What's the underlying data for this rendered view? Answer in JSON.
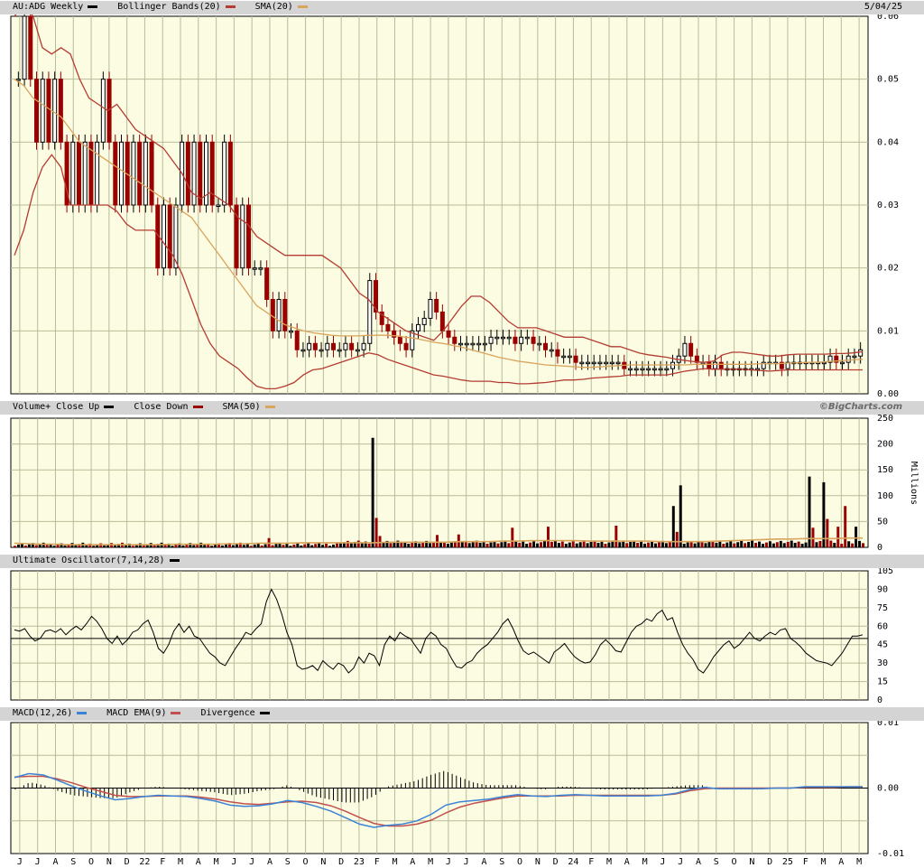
{
  "colors": {
    "up": "#000000",
    "down": "#9a0000",
    "band": "#b43c32",
    "sma": "#d9a45c",
    "macd": "#3b83d6",
    "macd_ema": "#c0504d",
    "grid": "#b8bc98",
    "panel_bg": "#fcfce2"
  },
  "price_panel": {
    "title_parts": [
      "AU:ADG Weekly",
      "Bollinger Bands(20)",
      "SMA(20)"
    ],
    "date": "5/04/25",
    "y_labels": [
      "0.06",
      "0.05",
      "0.04",
      "0.03",
      "0.02",
      "0.01",
      "0.00"
    ]
  },
  "volume_panel": {
    "title_parts": [
      "Volume+ Close Up",
      "Close Down",
      "SMA(50)"
    ],
    "brand": "©BigCharts.com",
    "y_labels": [
      "250",
      "200",
      "150",
      "100",
      "50",
      "0"
    ],
    "unit_label": "Millions"
  },
  "uo_panel": {
    "title": "Ultimate Oscillator(7,14,28)",
    "y_labels": [
      "105",
      "90",
      "75",
      "60",
      "45",
      "30",
      "15",
      "0"
    ]
  },
  "macd_panel": {
    "title_parts": [
      "MACD(12,26)",
      "MACD EMA(9)",
      "Divergence"
    ],
    "y_labels": [
      "0.01",
      "0.00",
      "-0.01"
    ]
  },
  "x_labels": [
    "J",
    "J",
    "A",
    "S",
    "O",
    "N",
    "D",
    "22",
    "F",
    "M",
    "A",
    "M",
    "J",
    "J",
    "A",
    "S",
    "O",
    "N",
    "D",
    "23",
    "F",
    "M",
    "A",
    "M",
    "J",
    "J",
    "A",
    "S",
    "O",
    "N",
    "D",
    "24",
    "F",
    "M",
    "A",
    "M",
    "J",
    "J",
    "A",
    "S",
    "O",
    "N",
    "D",
    "25",
    "F",
    "M",
    "A",
    "M"
  ],
  "chart_data": [
    {
      "type": "candlestick",
      "title": "AU:ADG Weekly",
      "ylim": [
        0,
        0.06
      ],
      "series": [
        {
          "name": "AU:ADG Weekly",
          "closes": [
            0.05,
            0.06,
            0.05,
            0.04,
            0.05,
            0.04,
            0.05,
            0.04,
            0.03,
            0.04,
            0.03,
            0.04,
            0.03,
            0.04,
            0.05,
            0.04,
            0.03,
            0.04,
            0.03,
            0.04,
            0.03,
            0.04,
            0.03,
            0.02,
            0.03,
            0.02,
            0.03,
            0.04,
            0.03,
            0.04,
            0.03,
            0.04,
            0.03,
            0.03,
            0.04,
            0.03,
            0.02,
            0.03,
            0.02,
            0.02,
            0.02,
            0.015,
            0.01,
            0.015,
            0.01,
            0.01,
            0.007,
            0.007,
            0.008,
            0.007,
            0.007,
            0.008,
            0.007,
            0.007,
            0.008,
            0.007,
            0.007,
            0.008,
            0.018,
            0.013,
            0.011,
            0.01,
            0.009,
            0.008,
            0.007,
            0.01,
            0.011,
            0.012,
            0.015,
            0.013,
            0.01,
            0.009,
            0.008,
            0.008,
            0.008,
            0.008,
            0.008,
            0.008,
            0.009,
            0.009,
            0.009,
            0.009,
            0.008,
            0.009,
            0.009,
            0.008,
            0.008,
            0.007,
            0.007,
            0.006,
            0.006,
            0.006,
            0.005,
            0.005,
            0.005,
            0.005,
            0.005,
            0.005,
            0.005,
            0.005,
            0.004,
            0.004,
            0.004,
            0.004,
            0.004,
            0.004,
            0.004,
            0.004,
            0.005,
            0.006,
            0.008,
            0.006,
            0.005,
            0.005,
            0.004,
            0.005,
            0.004,
            0.004,
            0.004,
            0.004,
            0.004,
            0.004,
            0.004,
            0.005,
            0.005,
            0.005,
            0.004,
            0.005,
            0.005,
            0.005,
            0.005,
            0.005,
            0.005,
            0.005,
            0.006,
            0.005,
            0.005,
            0.006,
            0.006,
            0.007
          ]
        },
        {
          "name": "Bollinger Bands(20) upper",
          "values": [
            0.06,
            0.062,
            0.06,
            0.055,
            0.054,
            0.055,
            0.054,
            0.05,
            0.047,
            0.046,
            0.045,
            0.046,
            0.044,
            0.042,
            0.041,
            0.04,
            0.039,
            0.037,
            0.035,
            0.032,
            0.031,
            0.032,
            0.031,
            0.03,
            0.028,
            0.027,
            0.025,
            0.024,
            0.023,
            0.022,
            0.022,
            0.022,
            0.022,
            0.022,
            0.021,
            0.02,
            0.018,
            0.016,
            0.015,
            0.013,
            0.012,
            0.011,
            0.01,
            0.0095,
            0.009,
            0.0085,
            0.01,
            0.012,
            0.014,
            0.0155,
            0.0155,
            0.0145,
            0.013,
            0.0115,
            0.0105,
            0.0105,
            0.0105,
            0.01,
            0.0095,
            0.009,
            0.009,
            0.009,
            0.0085,
            0.008,
            0.0075,
            0.0075,
            0.007,
            0.0065,
            0.0062,
            0.006,
            0.0058,
            0.0055,
            0.0053,
            0.0051,
            0.005,
            0.0052,
            0.0062,
            0.0066,
            0.0066,
            0.0064,
            0.0062,
            0.006,
            0.006,
            0.0062,
            0.0063,
            0.0063,
            0.0063,
            0.0063,
            0.0064,
            0.0064,
            0.0065,
            0.0067
          ]
        },
        {
          "name": "Bollinger Bands(20) lower",
          "values": [
            0.022,
            0.026,
            0.032,
            0.036,
            0.038,
            0.036,
            0.03,
            0.03,
            0.03,
            0.03,
            0.03,
            0.029,
            0.027,
            0.026,
            0.026,
            0.026,
            0.024,
            0.022,
            0.019,
            0.015,
            0.011,
            0.008,
            0.006,
            0.005,
            0.004,
            0.0025,
            0.0012,
            0.0008,
            0.0008,
            0.0012,
            0.0018,
            0.003,
            0.0038,
            0.004,
            0.0045,
            0.005,
            0.0055,
            0.006,
            0.0065,
            0.0062,
            0.0055,
            0.005,
            0.0045,
            0.004,
            0.0035,
            0.003,
            0.0028,
            0.0025,
            0.0022,
            0.002,
            0.002,
            0.002,
            0.0018,
            0.0018,
            0.0016,
            0.0016,
            0.0017,
            0.0018,
            0.002,
            0.0022,
            0.0022,
            0.0023,
            0.0025,
            0.0026,
            0.0027,
            0.0028,
            0.003,
            0.003,
            0.003,
            0.003,
            0.003,
            0.0033,
            0.0036,
            0.0038,
            0.004,
            0.0039,
            0.0039,
            0.0039,
            0.0039,
            0.0038,
            0.0037,
            0.0036,
            0.0037,
            0.0038,
            0.0038,
            0.0038,
            0.0038,
            0.0038,
            0.0038,
            0.0038,
            0.0038,
            0.0038
          ]
        },
        {
          "name": "SMA(20)",
          "values": [
            0.05,
            0.049,
            0.047,
            0.046,
            0.045,
            0.044,
            0.042,
            0.04,
            0.039,
            0.038,
            0.037,
            0.036,
            0.035,
            0.034,
            0.033,
            0.032,
            0.031,
            0.03,
            0.029,
            0.028,
            0.026,
            0.024,
            0.022,
            0.02,
            0.018,
            0.016,
            0.014,
            0.013,
            0.012,
            0.011,
            0.0105,
            0.01,
            0.0097,
            0.0095,
            0.0093,
            0.0092,
            0.0092,
            0.0092,
            0.0093,
            0.0093,
            0.0093,
            0.0092,
            0.009,
            0.0088,
            0.0085,
            0.0082,
            0.008,
            0.0077,
            0.0074,
            0.007,
            0.0066,
            0.0062,
            0.0058,
            0.0055,
            0.0052,
            0.005,
            0.0048,
            0.0046,
            0.0045,
            0.0044,
            0.0043,
            0.0042,
            0.0042,
            0.0043,
            0.0044,
            0.0045,
            0.0046,
            0.0046,
            0.0046,
            0.0046,
            0.0046,
            0.0046,
            0.0046,
            0.0047,
            0.0047,
            0.0047,
            0.0047,
            0.0047,
            0.0047,
            0.0047,
            0.0048,
            0.0048,
            0.0048,
            0.0049,
            0.0049,
            0.005,
            0.005,
            0.0051,
            0.0052,
            0.0053,
            0.0054,
            0.0055
          ]
        }
      ]
    },
    {
      "type": "bar",
      "title": "Volume+",
      "ylabel": "Millions",
      "ylim": [
        0,
        250
      ],
      "spikes": [
        {
          "idx": 100,
          "v": 212,
          "up": true
        },
        {
          "idx": 101,
          "v": 57,
          "up": false
        },
        {
          "idx": 102,
          "v": 22,
          "up": false
        },
        {
          "idx": 184,
          "v": 80,
          "up": true
        },
        {
          "idx": 185,
          "v": 30,
          "up": false
        },
        {
          "idx": 186,
          "v": 120,
          "up": true
        },
        {
          "idx": 222,
          "v": 137,
          "up": true
        },
        {
          "idx": 223,
          "v": 38,
          "up": false
        },
        {
          "idx": 226,
          "v": 126,
          "up": true
        },
        {
          "idx": 227,
          "v": 55,
          "up": false
        },
        {
          "idx": 232,
          "v": 80,
          "up": false
        },
        {
          "idx": 235,
          "v": 40,
          "up": true
        },
        {
          "idx": 230,
          "v": 40,
          "up": false
        },
        {
          "idx": 149,
          "v": 40,
          "up": false
        },
        {
          "idx": 139,
          "v": 38,
          "up": false
        },
        {
          "idx": 168,
          "v": 42,
          "up": false
        },
        {
          "idx": 71,
          "v": 18,
          "up": false
        },
        {
          "idx": 124,
          "v": 25,
          "up": false
        },
        {
          "idx": 118,
          "v": 24,
          "up": false
        }
      ],
      "sma50": [
        8,
        7,
        6,
        6,
        5,
        5,
        5,
        5,
        5,
        5,
        5,
        6,
        6,
        6,
        6,
        7,
        7,
        8,
        8,
        8,
        9,
        9,
        9,
        9,
        9,
        9,
        10,
        10,
        10,
        10,
        10,
        11,
        11,
        11,
        12,
        12,
        13,
        13,
        13,
        13,
        12,
        12,
        12,
        12,
        12,
        11,
        11,
        11,
        11,
        12,
        13,
        14,
        15,
        16,
        16,
        17,
        17,
        17,
        18,
        18
      ]
    },
    {
      "type": "line",
      "title": "Ultimate Oscillator(7,14,28)",
      "ylim": [
        0,
        105
      ],
      "reference": 50,
      "series": [
        {
          "name": "Ultimate Oscillator(7,14,28)",
          "values": [
            57,
            56,
            58,
            52,
            48,
            50,
            56,
            57,
            55,
            58,
            53,
            57,
            60,
            57,
            62,
            68,
            64,
            58,
            50,
            46,
            52,
            45,
            49,
            55,
            57,
            62,
            65,
            55,
            42,
            38,
            45,
            56,
            62,
            55,
            60,
            52,
            50,
            44,
            38,
            35,
            30,
            28,
            35,
            42,
            48,
            55,
            53,
            58,
            62,
            80,
            90,
            82,
            70,
            55,
            45,
            28,
            25,
            26,
            28,
            24,
            32,
            28,
            25,
            30,
            28,
            22,
            26,
            35,
            30,
            38,
            36,
            28,
            45,
            52,
            48,
            55,
            52,
            50,
            44,
            38,
            50,
            55,
            52,
            45,
            42,
            34,
            27,
            26,
            30,
            32,
            38,
            42,
            45,
            50,
            55,
            62,
            66,
            58,
            48,
            40,
            37,
            39,
            36,
            33,
            30,
            39,
            42,
            46,
            40,
            35,
            32,
            30,
            31,
            37,
            45,
            49,
            45,
            40,
            39,
            47,
            55,
            60,
            62,
            66,
            64,
            70,
            73,
            65,
            67,
            55,
            45,
            38,
            33,
            25,
            22,
            28,
            35,
            40,
            45,
            48,
            42,
            45,
            50,
            55,
            50,
            48,
            52,
            55,
            53,
            57,
            58,
            50,
            47,
            43,
            38,
            35,
            32,
            31,
            30,
            28,
            33,
            38,
            45,
            52,
            52,
            53
          ]
        }
      ]
    },
    {
      "type": "line",
      "title": "MACD(12,26)",
      "ylim": [
        -0.01,
        0.01
      ],
      "series": [
        {
          "name": "MACD(12,26)",
          "values": [
            0.0016,
            0.0022,
            0.002,
            0.0012,
            0.0003,
            -0.0005,
            -0.0012,
            -0.0018,
            -0.0016,
            -0.0013,
            -0.0011,
            -0.0012,
            -0.0013,
            -0.0016,
            -0.002,
            -0.0026,
            -0.0028,
            -0.0027,
            -0.0024,
            -0.0019,
            -0.0022,
            -0.0028,
            -0.0035,
            -0.0045,
            -0.0055,
            -0.006,
            -0.0057,
            -0.0055,
            -0.005,
            -0.004,
            -0.0026,
            -0.0021,
            -0.0019,
            -0.0017,
            -0.0013,
            -0.001,
            -0.0012,
            -0.0013,
            -0.0011,
            -0.001,
            -0.0011,
            -0.0012,
            -0.0012,
            -0.0012,
            -0.0012,
            -0.0011,
            -0.0008,
            -0.0002,
            0.0001,
            -0.0001,
            -0.0001,
            -0.0001,
            -0.0001,
            0,
            0,
            0.0002,
            0.0002,
            0.0002,
            0.0002,
            0.0002
          ]
        },
        {
          "name": "MACD EMA(9)",
          "values": [
            0.0017,
            0.0018,
            0.0018,
            0.0014,
            0.0008,
            0.0001,
            -0.0005,
            -0.0011,
            -0.0013,
            -0.0013,
            -0.0012,
            -0.0012,
            -0.0012,
            -0.0014,
            -0.0017,
            -0.0021,
            -0.0024,
            -0.0025,
            -0.0023,
            -0.0021,
            -0.002,
            -0.0022,
            -0.0027,
            -0.0035,
            -0.0045,
            -0.0054,
            -0.0058,
            -0.0058,
            -0.0055,
            -0.0049,
            -0.0038,
            -0.0029,
            -0.0023,
            -0.0019,
            -0.0015,
            -0.0012,
            -0.0012,
            -0.0012,
            -0.0012,
            -0.0011,
            -0.0011,
            -0.0011,
            -0.0011,
            -0.0011,
            -0.0011,
            -0.0011,
            -0.0009,
            -0.0004,
            -0.0001,
            0,
            0,
            0,
            0,
            0,
            0,
            0.0001,
            0.0001,
            0.0001,
            0.0002,
            0.0002
          ]
        }
      ]
    }
  ]
}
